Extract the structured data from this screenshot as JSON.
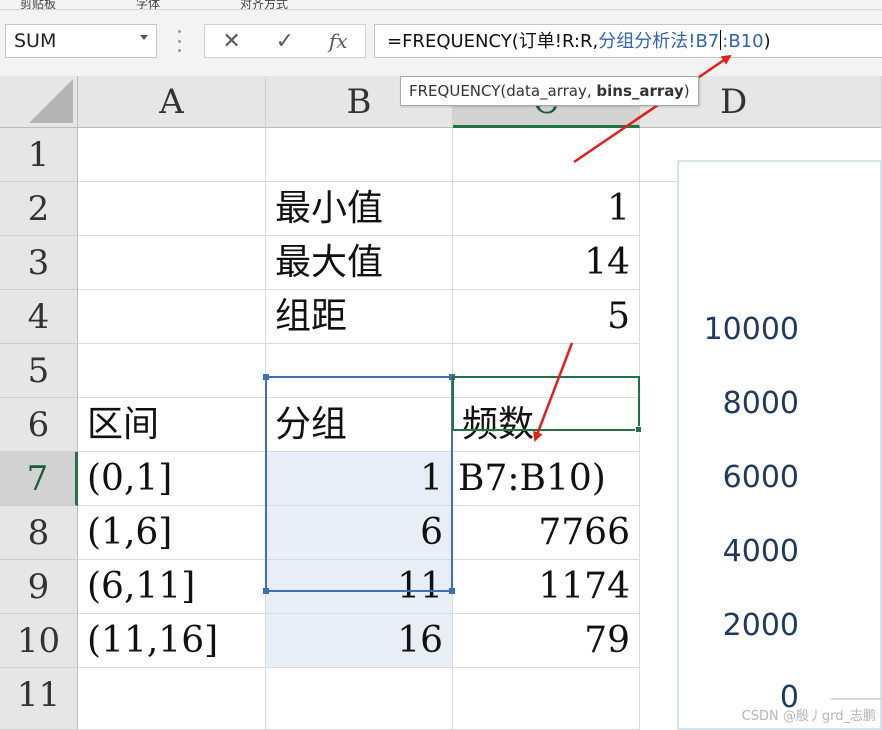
{
  "ribbon": {
    "fragments": [
      "剪贴板",
      "字体",
      "对齐方式"
    ]
  },
  "formula_bar": {
    "name_box": "SUM",
    "cancel_glyph": "✕",
    "enter_glyph": "✓",
    "fx_label": "fx",
    "formula_prefix": "=FREQUENCY(订单!R:R,",
    "formula_ref1": "分组分析法!B7",
    "formula_ref2": ":B10",
    "formula_suffix": ")"
  },
  "tooltip": {
    "prefix": "FREQUENCY(data_array, ",
    "bold_arg": "bins_array",
    "suffix": ")"
  },
  "columns": [
    "A",
    "B",
    "C",
    "D"
  ],
  "rows": [
    "1",
    "2",
    "3",
    "4",
    "5",
    "6",
    "7",
    "8",
    "9",
    "10",
    "11"
  ],
  "cells": {
    "B2": "最小值",
    "C2": "1",
    "B3": "最大值",
    "C3": "14",
    "B4": "组距",
    "C4": "5",
    "A6": "区间",
    "B6": "分组",
    "C6": "频数",
    "A7": "(0,1]",
    "B7": "1",
    "C7": "B7:B10)",
    "A8": "(1,6]",
    "B8": "6",
    "C8": "7766",
    "A9": "(6,11]",
    "B9": "11",
    "C9": "1174",
    "A10": "(11,16]",
    "B10": "16",
    "C10": "79"
  },
  "chart": {
    "y_ticks": [
      "10000",
      "8000",
      "6000",
      "4000",
      "2000",
      "0"
    ]
  },
  "watermark": "CSDN @殷丿grd_志鹏",
  "colors": {
    "accent_green": "#217346",
    "selection_blue": "#3f6fb5",
    "annotation_red": "#e0201b"
  }
}
